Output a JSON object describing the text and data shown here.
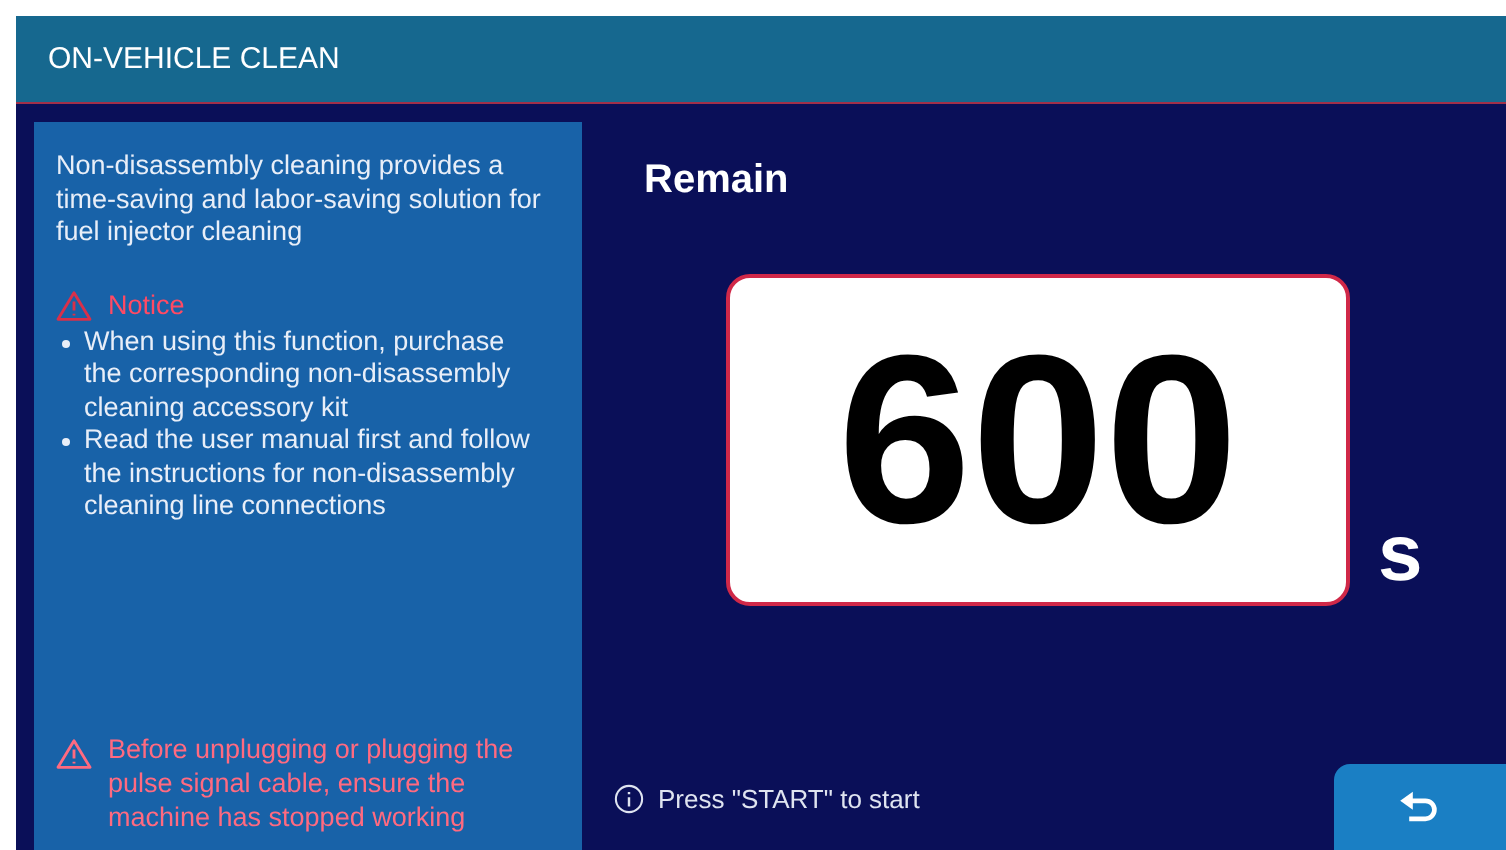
{
  "header": {
    "title": "ON-VEHICLE CLEAN"
  },
  "info_panel": {
    "description": "Non-disassembly cleaning provides a time-saving and labor-saving solution for fuel injector cleaning",
    "notice_title": "Notice",
    "notice_items": [
      "When using this function, purchase the corresponding non-disassembly cleaning accessory kit",
      "Read the user manual first and follow the instructions for non-disassembly cleaning line connections"
    ],
    "warning": "Before unplugging or plugging the pulse signal cable, ensure the machine has stopped working"
  },
  "timer": {
    "label": "Remain",
    "value": "600",
    "unit": "s"
  },
  "hint": "Press \"START\" to start",
  "back_button": {
    "disabled": false
  }
}
